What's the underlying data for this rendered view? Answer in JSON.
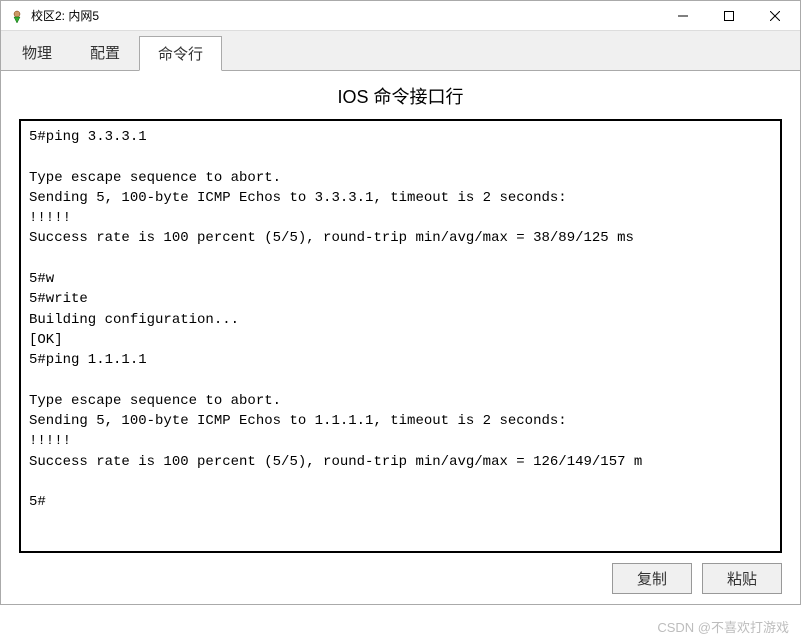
{
  "window": {
    "title": "校区2: 内网5"
  },
  "tabs": {
    "items": [
      {
        "label": "物理",
        "active": false
      },
      {
        "label": "配置",
        "active": false
      },
      {
        "label": "命令行",
        "active": true
      }
    ]
  },
  "heading": "IOS 命令接口行",
  "terminal": {
    "lines": "5#ping 3.3.3.1\n\nType escape sequence to abort.\nSending 5, 100-byte ICMP Echos to 3.3.3.1, timeout is 2 seconds:\n!!!!!\nSuccess rate is 100 percent (5/5), round-trip min/avg/max = 38/89/125 ms\n\n5#w\n5#write\nBuilding configuration...\n[OK]\n5#ping 1.1.1.1\n\nType escape sequence to abort.\nSending 5, 100-byte ICMP Echos to 1.1.1.1, timeout is 2 seconds:\n!!!!!\nSuccess rate is 100 percent (5/5), round-trip min/avg/max = 126/149/157 m\n\n5#"
  },
  "buttons": {
    "copy": "复制",
    "paste": "粘贴"
  },
  "watermark": "CSDN @不喜欢打游戏"
}
